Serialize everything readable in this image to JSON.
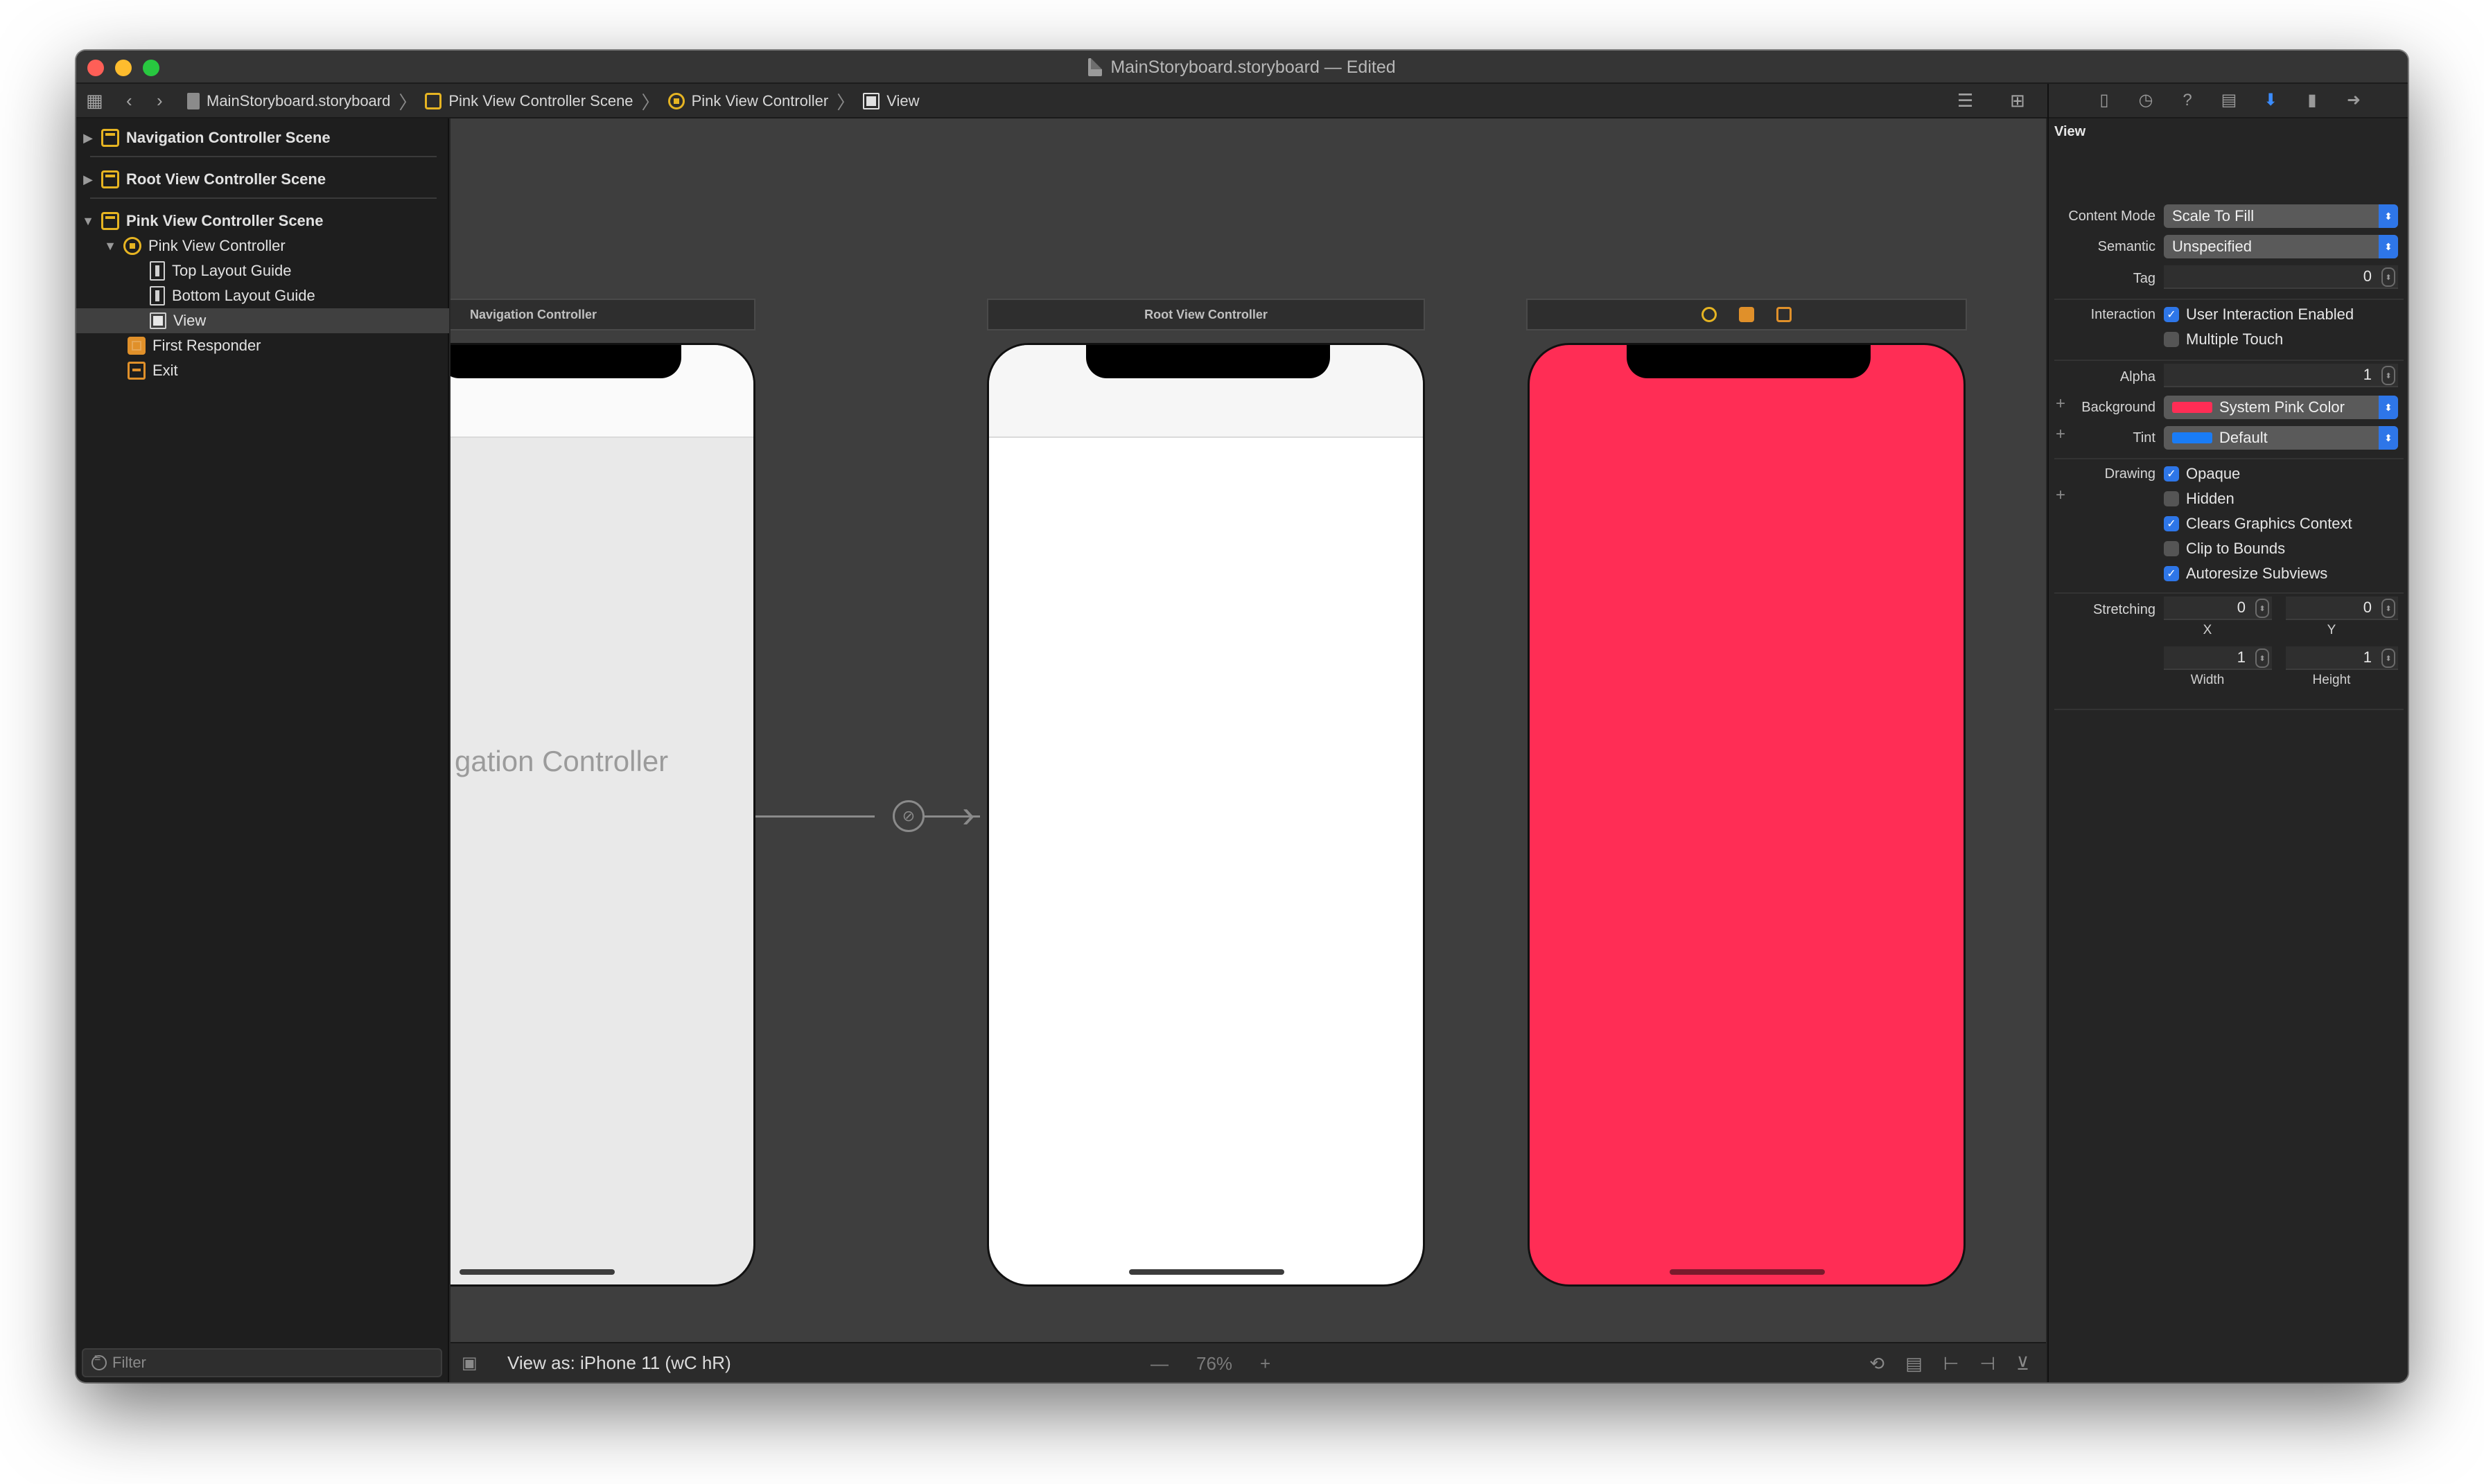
{
  "window": {
    "title": "MainStoryboard.storyboard — Edited"
  },
  "breadcrumb": [
    {
      "label": "MainStoryboard.storyboard",
      "icon": "storyboard-file-icon"
    },
    {
      "label": "Pink View Controller Scene",
      "icon": "scene-icon"
    },
    {
      "label": "Pink View Controller",
      "icon": "view-controller-icon"
    },
    {
      "label": "View",
      "icon": "view-icon"
    }
  ],
  "outline": {
    "scenes": [
      {
        "label": "Navigation Controller Scene",
        "expanded": false
      },
      {
        "label": "Root View Controller Scene",
        "expanded": false
      },
      {
        "label": "Pink View Controller Scene",
        "expanded": true
      }
    ],
    "children": [
      {
        "label": "Pink View Controller"
      },
      {
        "label": "Top Layout Guide"
      },
      {
        "label": "Bottom Layout Guide"
      },
      {
        "label": "View",
        "selected": true
      },
      {
        "label": "First Responder"
      },
      {
        "label": "Exit"
      }
    ],
    "filter_placeholder": "Filter"
  },
  "canvas": {
    "scenes": [
      {
        "title": "Navigation Controller",
        "ghost_text": "gation Controller"
      },
      {
        "title": "Root View Controller"
      },
      {
        "title": "",
        "background": "#ff2d55"
      }
    ],
    "view_as": "View as: iPhone 11 (wC hR)",
    "zoom": "76%",
    "zoom_minus": "—",
    "zoom_plus": "+"
  },
  "inspector": {
    "section_title": "View",
    "content_mode_label": "Content Mode",
    "content_mode_value": "Scale To Fill",
    "semantic_label": "Semantic",
    "semantic_value": "Unspecified",
    "tag_label": "Tag",
    "tag_value": "0",
    "interaction_label": "Interaction",
    "user_interaction_label": "User Interaction Enabled",
    "user_interaction_checked": true,
    "multiple_touch_label": "Multiple Touch",
    "multiple_touch_checked": false,
    "alpha_label": "Alpha",
    "alpha_value": "1",
    "background_label": "Background",
    "background_value": "System Pink Color",
    "background_color": "#ff2d55",
    "tint_label": "Tint",
    "tint_value": "Default",
    "tint_color": "#1a7cf5",
    "drawing_label": "Drawing",
    "opaque_label": "Opaque",
    "opaque_checked": true,
    "hidden_label": "Hidden",
    "hidden_checked": false,
    "clears_label": "Clears Graphics Context",
    "clears_checked": true,
    "clip_label": "Clip to Bounds",
    "clip_checked": false,
    "autoresize_label": "Autoresize Subviews",
    "autoresize_checked": true,
    "stretching_label": "Stretching",
    "stretch_x": "0",
    "stretch_y": "0",
    "stretch_x_label": "X",
    "stretch_y_label": "Y",
    "stretch_w": "1",
    "stretch_h": "1",
    "stretch_w_label": "Width",
    "stretch_h_label": "Height"
  },
  "colors": {
    "accent": "#2e76e8",
    "pink": "#ff2d55",
    "storyboard_icon": "#e6b422"
  }
}
